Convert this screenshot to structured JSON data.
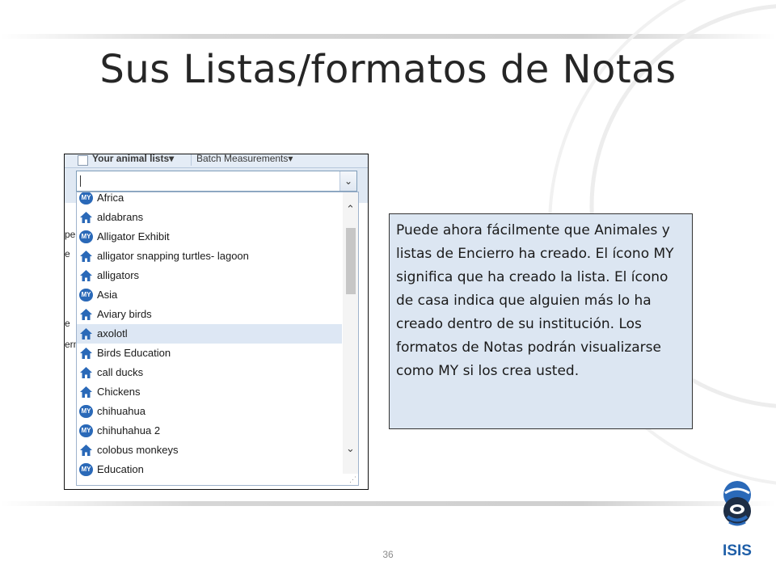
{
  "slide": {
    "title": "Sus Listas/formatos de Notas",
    "page_number": "36"
  },
  "screenshot": {
    "toolbar": {
      "animal_lists_label": "Your animal lists",
      "batch_label": "Batch Measurements"
    },
    "left_fragments": [
      "pe",
      "e",
      "e",
      "erm"
    ],
    "combo_value": "",
    "items": [
      {
        "label": "Africa",
        "icon": "my-badge-icon"
      },
      {
        "label": "aldabrans",
        "icon": "house-icon"
      },
      {
        "label": "Alligator Exhibit",
        "icon": "my-badge-icon"
      },
      {
        "label": "alligator snapping turtles- lagoon",
        "icon": "house-icon"
      },
      {
        "label": "alligators",
        "icon": "house-icon"
      },
      {
        "label": "Asia",
        "icon": "my-badge-icon"
      },
      {
        "label": "Aviary birds",
        "icon": "house-icon"
      },
      {
        "label": "axolotl",
        "icon": "house-icon",
        "selected": true
      },
      {
        "label": "Birds Education",
        "icon": "house-icon"
      },
      {
        "label": "call ducks",
        "icon": "house-icon"
      },
      {
        "label": "Chickens",
        "icon": "house-icon"
      },
      {
        "label": "chihuahua",
        "icon": "my-badge-icon"
      },
      {
        "label": "chihuhahua 2",
        "icon": "my-badge-icon"
      },
      {
        "label": "colobus monkeys",
        "icon": "house-icon"
      },
      {
        "label": "Education",
        "icon": "my-badge-icon"
      }
    ],
    "my_badge_text": "MY"
  },
  "note": {
    "text": "Puede ahora fácilmente que Animales y listas de Encierro ha creado. El ícono MY significa que ha creado la lista. El ícono de casa indica que alguien más lo ha creado dentro de su institución.  Los formatos de Notas podrán visualizarse como MY si los crea usted."
  },
  "logo": {
    "text": "ISIS",
    "color": "#1f5fa8"
  },
  "colors": {
    "my_badge": "#2a69b8",
    "house": "#2a69b8",
    "note_bg": "#dce6f2"
  }
}
